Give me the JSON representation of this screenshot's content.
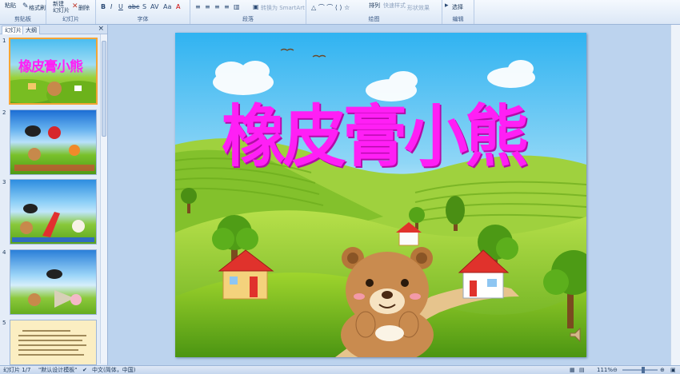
{
  "ribbon": {
    "clipboard": {
      "paste": "粘贴",
      "format_painter": "格式刷",
      "label": "剪贴板"
    },
    "slides": {
      "new_slide": "新建\n幻灯片",
      "delete": "删除",
      "label": "幻灯片"
    },
    "font": {
      "label": "字体"
    },
    "paragraph": {
      "convert_smartart": "转换为 SmartArt",
      "label": "段落"
    },
    "drawing": {
      "arrange": "排列",
      "quick_styles": "快速样式",
      "shape_effects": "形状效果",
      "label": "绘图"
    },
    "editing": {
      "select": "选择",
      "label": "编辑"
    }
  },
  "panel": {
    "tab_slides": "幻灯片",
    "tab_outline": "大纲",
    "close": "×",
    "thumbs": [
      {
        "num": "1"
      },
      {
        "num": "2"
      },
      {
        "num": "3"
      },
      {
        "num": "4"
      },
      {
        "num": "5"
      }
    ]
  },
  "slide": {
    "title": "橡皮膏小熊"
  },
  "thumb1": {
    "title": "橡皮膏小熊"
  },
  "status": {
    "slide_count": "幻灯片 1/7",
    "theme": "\"默认设计模板\"",
    "language": "中文(简体，中国)",
    "zoom": "111%"
  },
  "colors": {
    "title": "#ff1ff5",
    "sky_top": "#33b6f2",
    "hill": "#8ccd18",
    "ribbon_bg": "#dbe7f6"
  }
}
